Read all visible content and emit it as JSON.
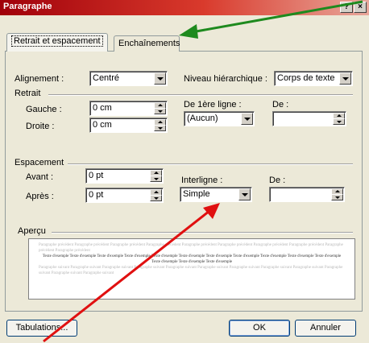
{
  "window": {
    "title": "Paragraphe",
    "help_glyph": "?",
    "close_glyph": "×"
  },
  "tabs": [
    {
      "label": "Retrait et espacement",
      "active": true
    },
    {
      "label": "Enchaînements",
      "active": false
    }
  ],
  "alignment": {
    "label": "Alignement :",
    "value": "Centré"
  },
  "outline": {
    "label": "Niveau hiérarchique :",
    "value": "Corps de texte"
  },
  "indent": {
    "group_label": "Retrait",
    "left_label": "Gauche :",
    "left_value": "0 cm",
    "right_label": "Droite :",
    "right_value": "0 cm",
    "first_line_label": "De 1ère ligne :",
    "first_line_value": "(Aucun)",
    "by_label": "De :",
    "by_value": ""
  },
  "spacing": {
    "group_label": "Espacement",
    "before_label": "Avant :",
    "before_value": "0 pt",
    "after_label": "Après :",
    "after_value": "0 pt",
    "line_label": "Interligne :",
    "line_value": "Simple",
    "at_label": "De :",
    "at_value": ""
  },
  "preview": {
    "group_label": "Aperçu",
    "prev_text": "Paragraphe précédent Paragraphe précédent Paragraphe précédent Paragraphe précédent Paragraphe précédent Paragraphe précédent Paragraphe précédent Paragraphe précédent Paragraphe précédent Paragraphe précédent",
    "sample_text": "Texte d'exemple Texte d'exemple Texte d'exemple Texte d'exemple Texte d'exemple Texte d'exemple Texte d'exemple Texte d'exemple Texte d'exemple Texte d'exemple Texte d'exemple Texte d'exemple Texte d'exemple Texte d'exemple",
    "next_text": "Paragraphe suivant Paragraphe suivant Paragraphe suivant Paragraphe suivant Paragraphe suivant Paragraphe suivant Paragraphe suivant Paragraphe suivant Paragraphe suivant Paragraphe suivant Paragraphe suivant Paragraphe suivant"
  },
  "buttons": {
    "tabs": "Tabulations...",
    "ok": "OK",
    "cancel": "Annuler"
  },
  "colors": {
    "annotation_green": "#1e8a1e",
    "annotation_red": "#e01010",
    "title_red": "#b3150f"
  }
}
